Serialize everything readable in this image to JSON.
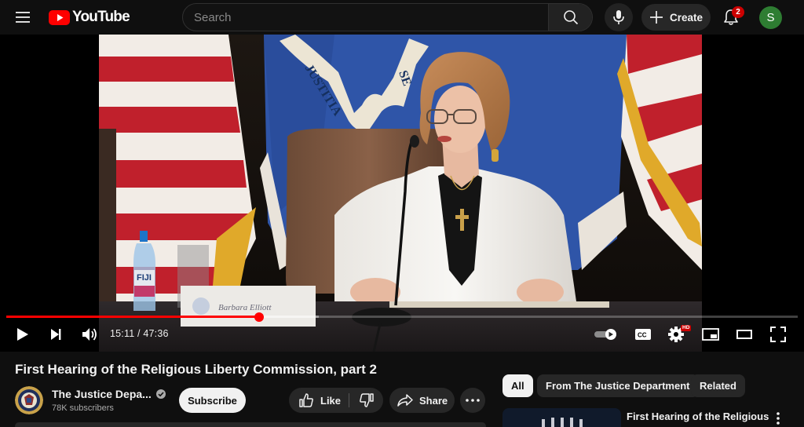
{
  "header": {
    "logo_text": "YouTube",
    "search_placeholder": "Search",
    "create_label": "Create",
    "notification_count": "2",
    "avatar_initial": "S",
    "icons": [
      "menu-icon",
      "youtube-logo-icon",
      "search-icon",
      "mic-icon",
      "plus-icon",
      "bell-icon"
    ]
  },
  "player": {
    "nameplate": "Barbara Elliott",
    "bottle_label": "FIJI",
    "flag_text_1": "JUSTITIA",
    "flag_text_2": "SE",
    "current_time": "15:11",
    "duration": "47:36",
    "time_display": "15:11 / 47:36",
    "progress_fraction": 0.319,
    "loaded_fraction": 0.395,
    "quality_badge": "HD",
    "icons": [
      "play-icon",
      "next-icon",
      "volume-icon",
      "autoplay-toggle-icon",
      "captions-icon",
      "settings-icon",
      "miniplayer-icon",
      "theater-icon",
      "fullscreen-icon"
    ]
  },
  "video": {
    "title": "First Hearing of the Religious Liberty Commission, part 2",
    "channel_name": "The Justice Depa...",
    "subscribers": "78K subscribers",
    "subscribe_label": "Subscribe",
    "like_label": "Like",
    "share_label": "Share"
  },
  "related": {
    "chips": [
      "All",
      "From The Justice Department",
      "Related"
    ],
    "active_chip": "All",
    "first_item_title": "First Hearing of the Religious"
  },
  "colors": {
    "background": "#0f0f0f",
    "accent_red": "#ff0000",
    "chip_bg": "#272727",
    "avatar_bg": "#2e7d32"
  }
}
